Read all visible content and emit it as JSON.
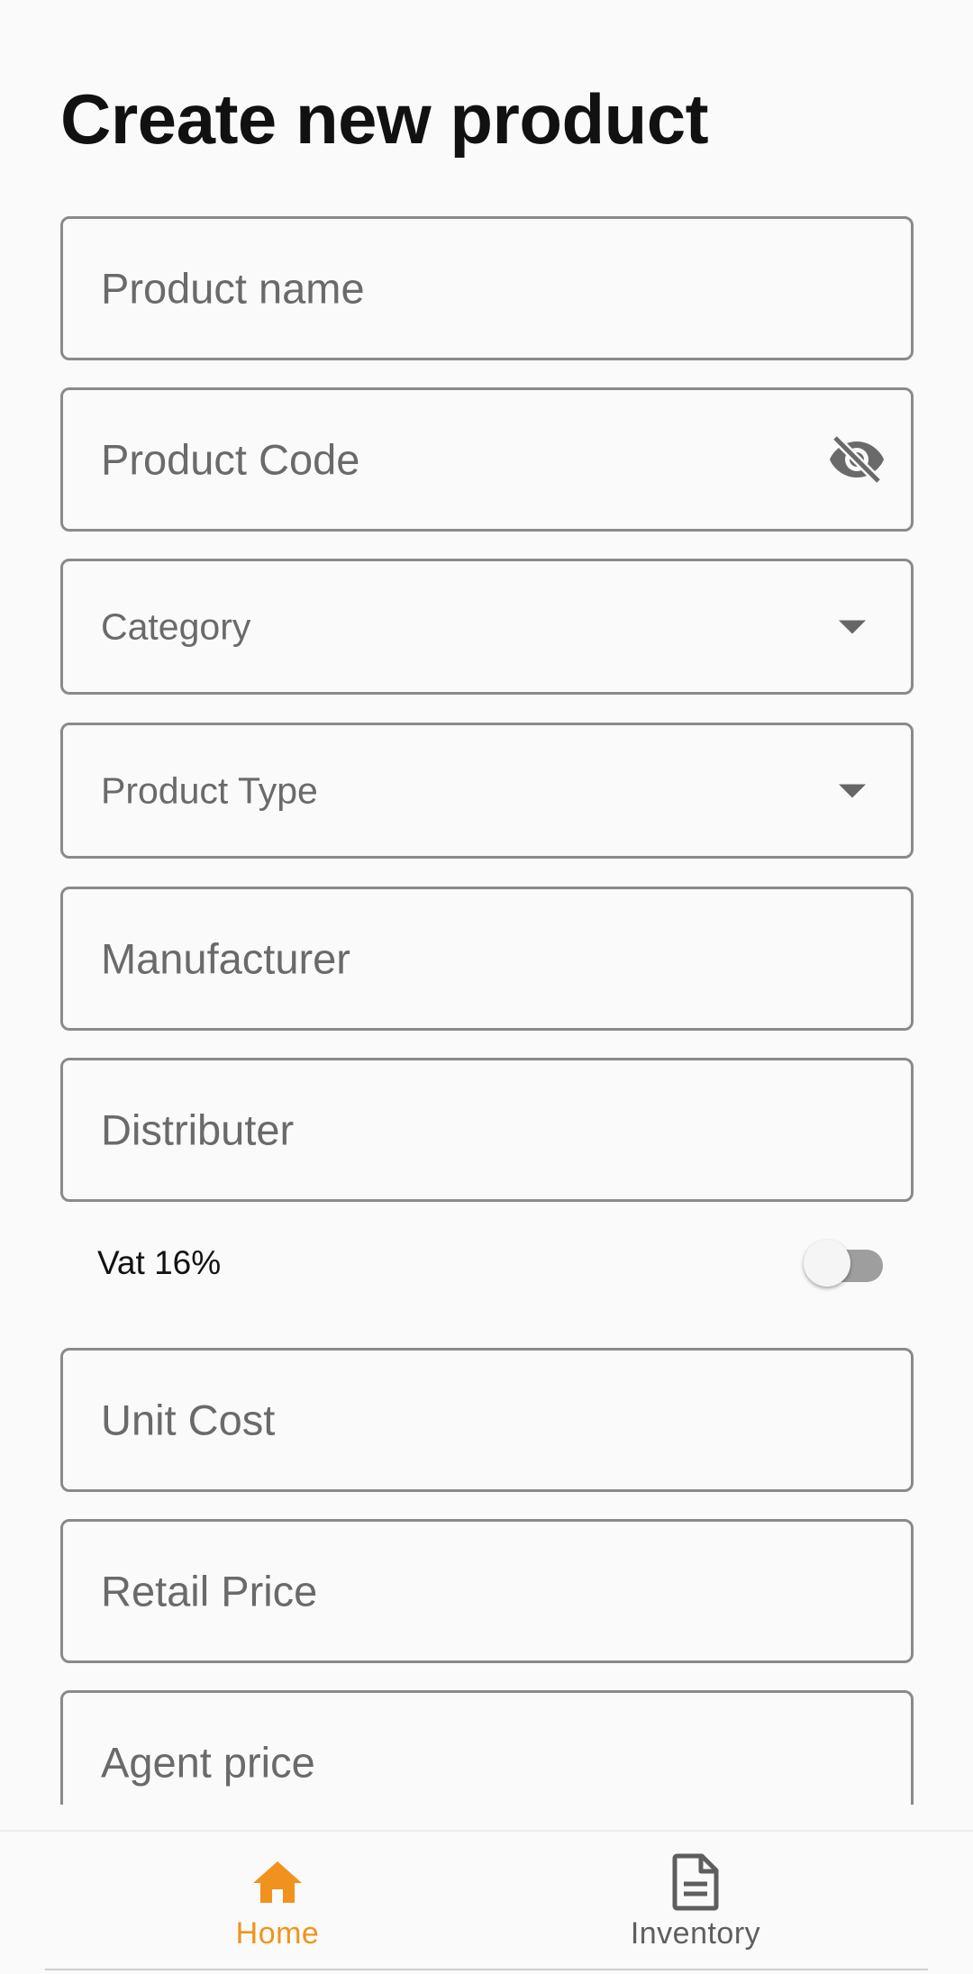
{
  "page": {
    "title": "Create new product"
  },
  "form": {
    "product_name_placeholder": "Product name",
    "product_code_placeholder": "Product Code",
    "category_placeholder": "Category",
    "product_type_placeholder": "Product Type",
    "manufacturer_placeholder": "Manufacturer",
    "distributer_placeholder": "Distributer",
    "vat_label": "Vat 16%",
    "vat_enabled": false,
    "unit_cost_placeholder": "Unit Cost",
    "retail_price_placeholder": "Retail Price",
    "agent_price_placeholder": "Agent price"
  },
  "icons": {
    "product_code_trailing": "eye-off-icon",
    "category_trailing": "chevron-down-icon",
    "product_type_trailing": "chevron-down-icon",
    "home": "home-icon",
    "inventory": "document-icon"
  },
  "bottom_nav": {
    "items": [
      {
        "label": "Home",
        "active": true
      },
      {
        "label": "Inventory",
        "active": false
      }
    ]
  },
  "colors": {
    "accent": "#f2921e",
    "field_border": "#8a8a8a",
    "placeholder": "#6a6a6a",
    "inactive_nav": "#5e5e5e"
  }
}
